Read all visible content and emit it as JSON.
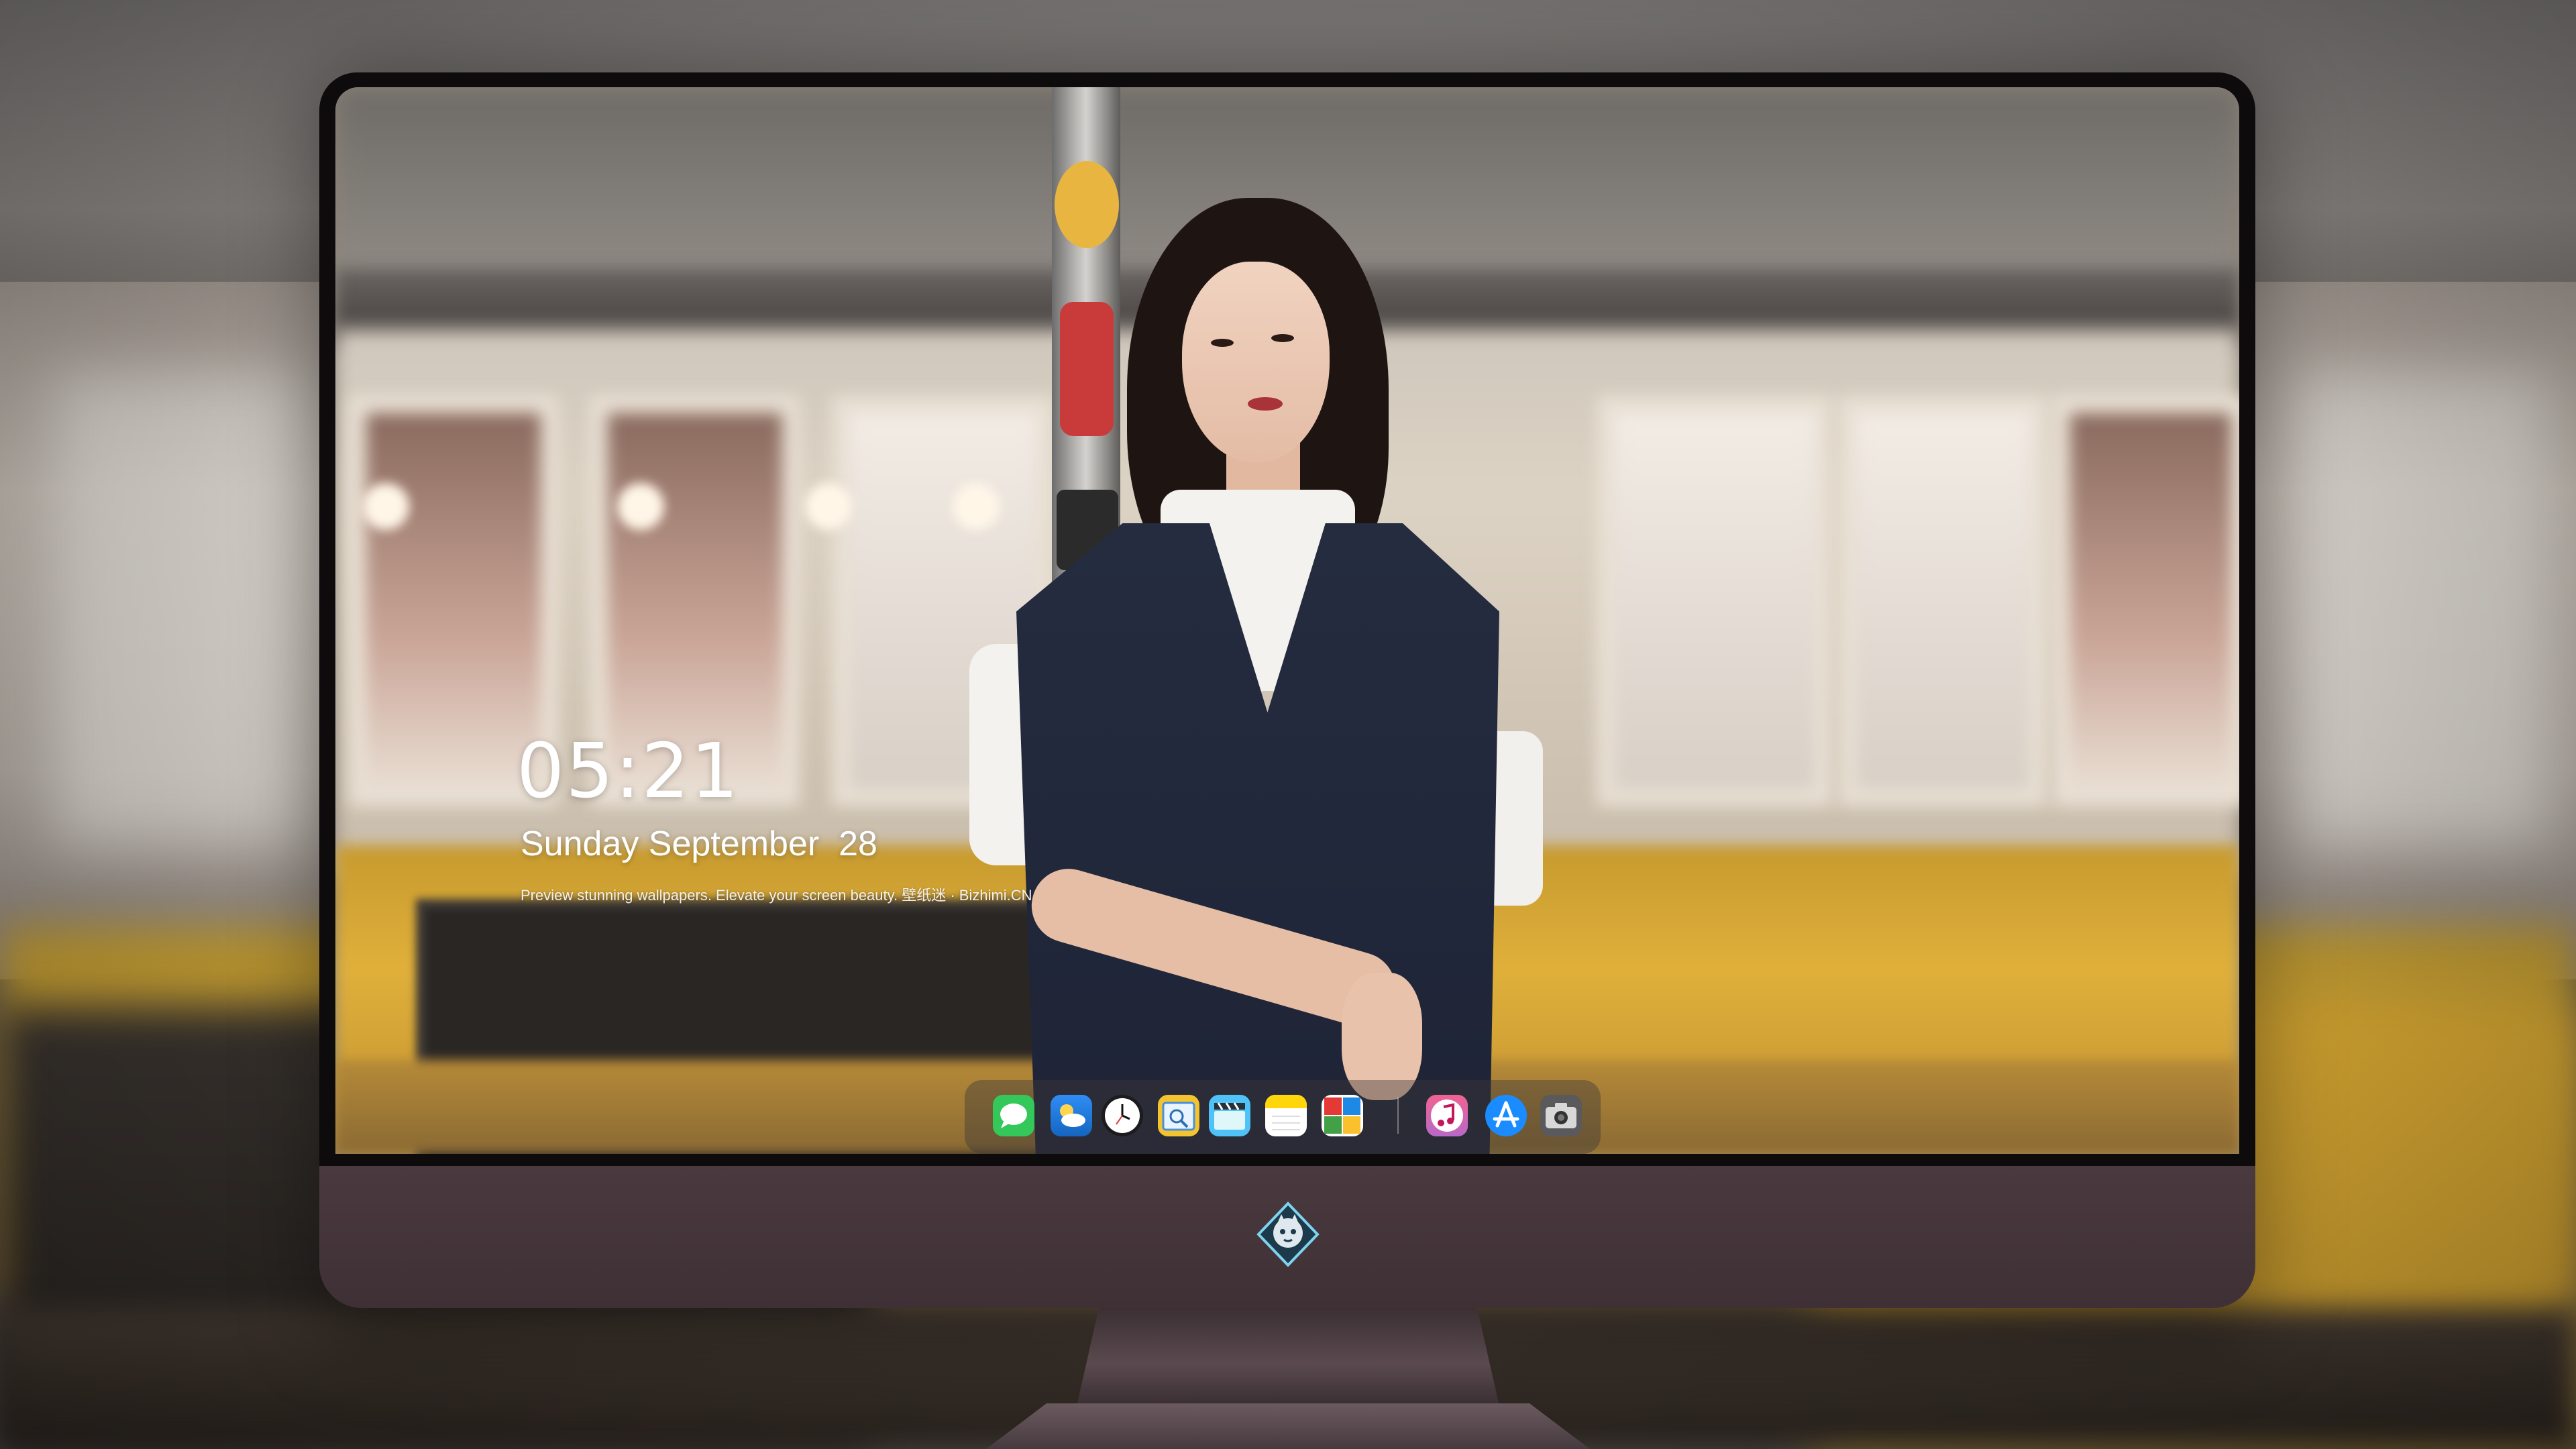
{
  "lock_screen": {
    "time": "05:21",
    "date": "Sunday September  28",
    "tagline": "Preview stunning wallpapers. Elevate your screen beauty. 壁纸迷 · Bizhimi.CN"
  },
  "dock": {
    "apps": [
      {
        "name": "messages-icon",
        "color": "#34c759"
      },
      {
        "name": "weather-icon",
        "color": "#1e90ff"
      },
      {
        "name": "clock-icon",
        "color": "#1c1c1e"
      },
      {
        "name": "preview-icon",
        "color": "#f4c430"
      },
      {
        "name": "claquette-icon",
        "color": "#4fc3f7"
      },
      {
        "name": "notes-icon",
        "color": "#ffd60a"
      },
      {
        "name": "photo-booth-icon",
        "color": "#ffffff"
      },
      {
        "name": "itunes-icon",
        "color": "#e040fb"
      },
      {
        "name": "app-store-icon",
        "color": "#1a8cff"
      },
      {
        "name": "camera-icon",
        "color": "#5a5a5c"
      }
    ]
  },
  "colors": {
    "bezel": "#0d0b0c",
    "chin": "#45363b",
    "text": "#ffffff"
  }
}
